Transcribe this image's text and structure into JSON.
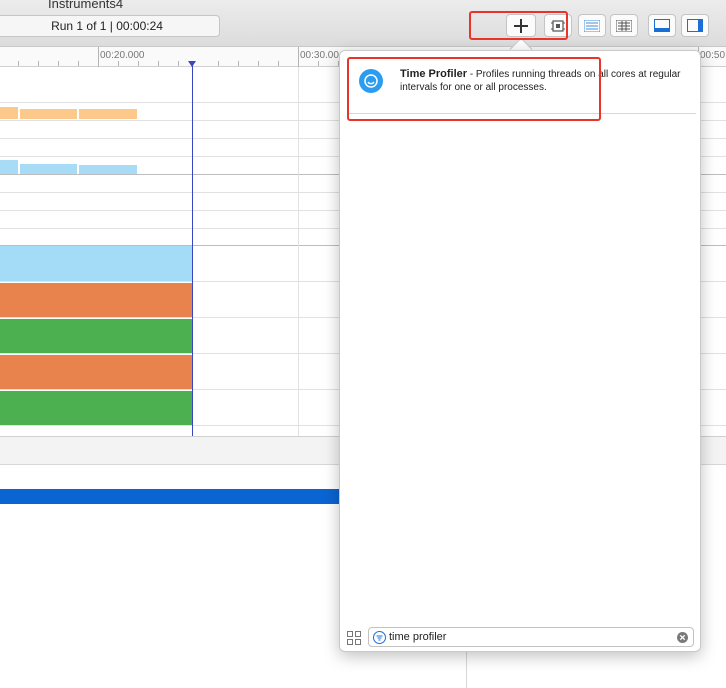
{
  "window": {
    "title": "Instruments4"
  },
  "toolbar": {
    "run_info": "Run 1 of 1  |  00:00:24"
  },
  "ruler": {
    "labels": [
      "00:20.000",
      "00:30.00",
      "00:50"
    ]
  },
  "popover": {
    "result": {
      "title": "Time Profiler",
      "description": " - Profiles running threads on all cores at regular intervals for one or all processes."
    },
    "search": {
      "value": "time profiler"
    }
  },
  "colors": {
    "orange_light": "#fcc98a",
    "blue_light": "#a8dbf5",
    "track_blue": "#a4dcf8",
    "track_orange": "#e8834d",
    "track_green": "#4caf50",
    "selection_blue": "#0a64d2",
    "highlight_red": "#e8352c"
  }
}
